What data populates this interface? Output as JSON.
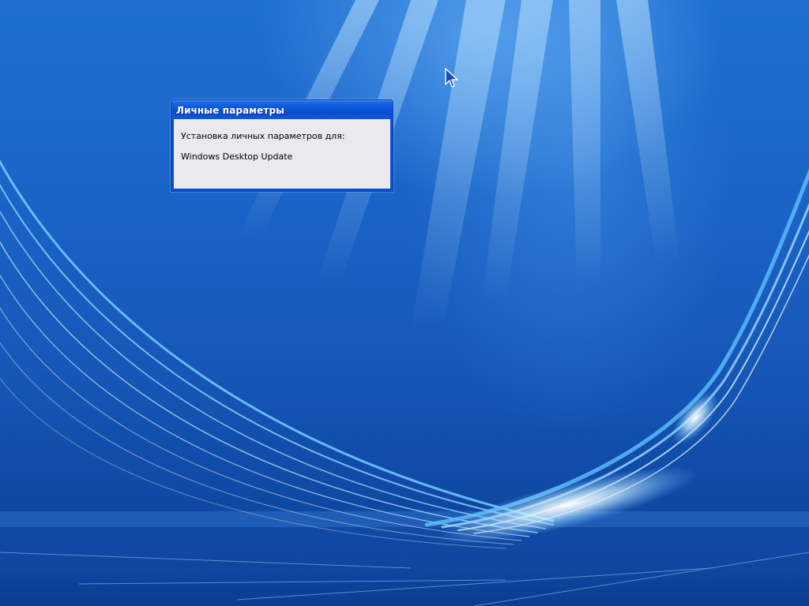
{
  "dialog": {
    "title": "Личные параметры",
    "message": "Установка личных параметров для:",
    "component": "Windows Desktop Update"
  },
  "cursor": {
    "icon": "arrow-cursor-icon"
  },
  "colors": {
    "desktop_blue": "#1658b8",
    "titlebar_blue": "#0b55d8",
    "dialog_body": "#e9e9ee"
  }
}
